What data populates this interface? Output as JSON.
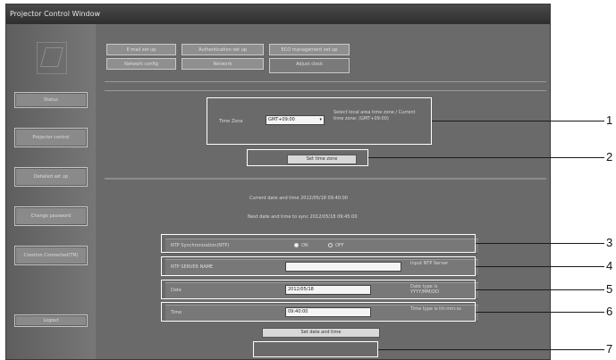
{
  "window": {
    "title": "Projector Control Window"
  },
  "sidebar": {
    "items": [
      {
        "label": "Status"
      },
      {
        "label": "Projector control"
      },
      {
        "label": "Detailed set up"
      },
      {
        "label": "Change password"
      },
      {
        "label": "Crestron Connected(TM)"
      },
      {
        "label": "Logout"
      }
    ]
  },
  "tabs": [
    {
      "label": "E-mail set up"
    },
    {
      "label": "Authentication set up"
    },
    {
      "label": "ECO management set up"
    },
    {
      "label": "Network config"
    },
    {
      "label": "Network"
    },
    {
      "label": "Adjust clock"
    }
  ],
  "timezone": {
    "label": "Time Zone",
    "value": "GMT+09:00",
    "note": "Select local area time zone / Current time zone: (GMT+09:00)"
  },
  "set_timezone_button": "Set time zone",
  "current_date": "Current date and time 2012/05/18 09:40:00",
  "next_update": "Next date and time to sync 2012/05/18 09:45:00",
  "ntp_sync": {
    "label": "NTP Synchronization(NTP)",
    "on": "ON",
    "off": "OFF",
    "selected": "on"
  },
  "ntp_server": {
    "label": "NTP SERVER NAME",
    "value": "",
    "note": "Input NTP Server"
  },
  "date": {
    "label": "Date",
    "value": "2012/05/18",
    "note": "Date type is YYYY/MM/DD"
  },
  "time": {
    "label": "Time",
    "value": "09:40:00",
    "note": "Time type is hh:mm:ss"
  },
  "set_datetime_button": "Set date and time",
  "callouts": [
    "1",
    "2",
    "3",
    "4",
    "5",
    "6",
    "7"
  ]
}
